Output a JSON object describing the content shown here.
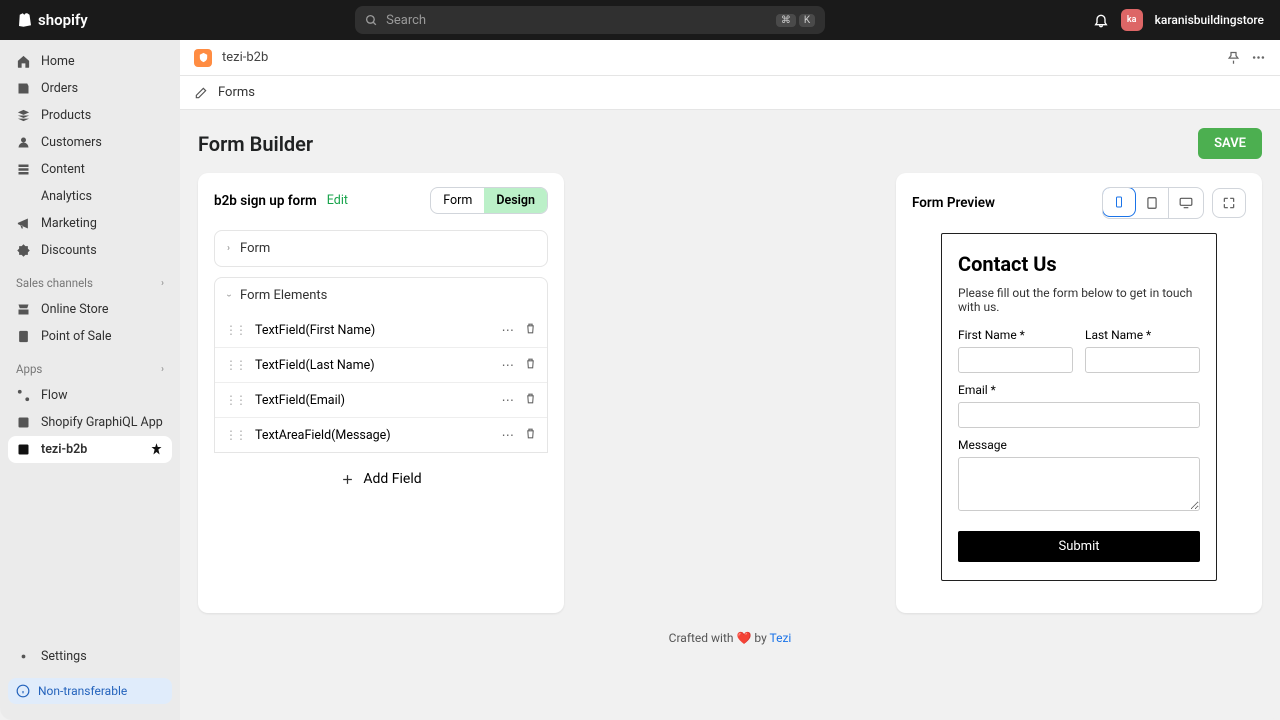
{
  "topbar": {
    "brand": "shopify",
    "search_placeholder": "Search",
    "kbd1": "⌘",
    "kbd2": "K",
    "username": "karanisbuildingstore",
    "avatar_initials": "ka"
  },
  "sidebar": {
    "nav": [
      {
        "label": "Home"
      },
      {
        "label": "Orders"
      },
      {
        "label": "Products"
      },
      {
        "label": "Customers"
      },
      {
        "label": "Content"
      },
      {
        "label": "Analytics"
      },
      {
        "label": "Marketing"
      },
      {
        "label": "Discounts"
      }
    ],
    "sales_header": "Sales channels",
    "sales": [
      {
        "label": "Online Store"
      },
      {
        "label": "Point of Sale"
      }
    ],
    "apps_header": "Apps",
    "apps": [
      {
        "label": "Flow"
      },
      {
        "label": "Shopify GraphiQL App"
      },
      {
        "label": "tezi-b2b"
      }
    ],
    "settings": "Settings",
    "non_transferable": "Non-transferable"
  },
  "app": {
    "name": "tezi-b2b",
    "crumb": "Forms"
  },
  "builder": {
    "title": "Form Builder",
    "save": "SAVE",
    "form_name": "b2b sign up form",
    "edit": "Edit",
    "seg_form": "Form",
    "seg_design": "Design",
    "acc_form": "Form",
    "acc_elements": "Form Elements",
    "fields": [
      {
        "label": "TextField(First Name)"
      },
      {
        "label": "TextField(Last Name)"
      },
      {
        "label": "TextField(Email)"
      },
      {
        "label": "TextAreaField(Message)"
      }
    ],
    "add_field": "Add Field"
  },
  "preview": {
    "title": "Form Preview",
    "heading": "Contact Us",
    "desc": "Please fill out the form below to get in touch with us.",
    "first": "First Name *",
    "last": "Last Name *",
    "email": "Email *",
    "message": "Message",
    "submit": "Submit"
  },
  "footer": {
    "pre": "Crafted with ",
    "heart": "❤️",
    "by": " by ",
    "brand": "Tezi"
  }
}
